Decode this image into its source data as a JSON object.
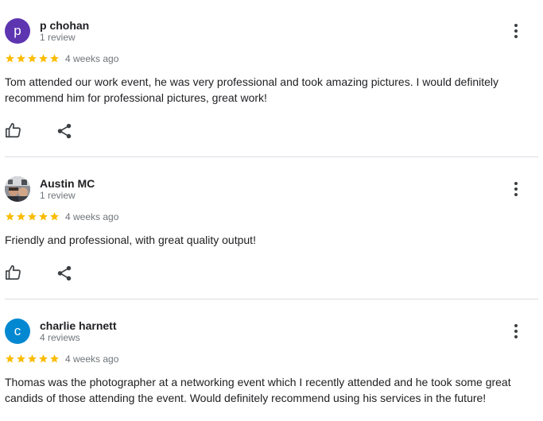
{
  "colors": {
    "star": "#fbbc04",
    "avatar_p": "#5e35b1",
    "avatar_c": "#0288d1",
    "icon": "#3c4043"
  },
  "reviews": [
    {
      "avatar_letter": "p",
      "avatar_icon": "avatar-letter-p",
      "name": "p chohan",
      "count": "1 review",
      "rating": 5,
      "date": "4 weeks ago",
      "text": "Tom attended our work event, he was very professional and took amazing pictures. I would definitely recommend him for professional pictures, great work!"
    },
    {
      "avatar_letter": "",
      "avatar_icon": "avatar-photo",
      "name": "Austin MC",
      "count": "1 review",
      "rating": 5,
      "date": "4 weeks ago",
      "text": "Friendly and professional, with great quality output!"
    },
    {
      "avatar_letter": "c",
      "avatar_icon": "avatar-letter-c",
      "name": "charlie harnett",
      "count": "4 reviews",
      "rating": 5,
      "date": "4 weeks ago",
      "text": "Thomas was the photographer at a networking event which I recently attended and he took some great candids of those attending the event. Would definitely recommend using his services in the future!"
    }
  ]
}
